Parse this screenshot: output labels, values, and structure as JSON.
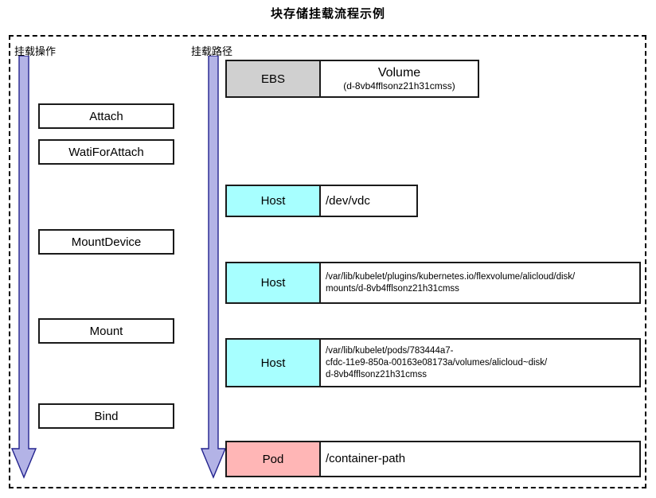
{
  "title": "块存储挂载流程示例",
  "columns": {
    "operation_caption": "挂载操作",
    "path_caption": "挂载路径"
  },
  "colors": {
    "arrow_fill": "#b3b3e6",
    "arrow_stroke": "#23238e",
    "ebs_fill": "#d0d0d0",
    "host_fill": "#a7ffff",
    "pod_fill": "#ffb6b6",
    "box_border": "#1a1a1a",
    "frame_border": "#000000"
  },
  "operations": [
    {
      "label": "Attach"
    },
    {
      "label": "WatiForAttach"
    },
    {
      "label": "MountDevice"
    },
    {
      "label": "Mount"
    },
    {
      "label": "Bind"
    }
  ],
  "paths": [
    {
      "label": "EBS",
      "fill": "ebs",
      "value_main": "Volume",
      "value_sub": "(d-8vb4fflsonz21h31cmss)"
    },
    {
      "label": "Host",
      "fill": "host",
      "value_main": "/dev/vdc"
    },
    {
      "label": "Host",
      "fill": "host",
      "value_lines": [
        "/var/lib/kubelet/plugins/kubernetes.io/flexvolume/alicloud/disk/",
        "mounts/d-8vb4fflsonz21h31cmss"
      ]
    },
    {
      "label": "Host",
      "fill": "host",
      "value_lines": [
        "/var/lib/kubelet/pods/783444a7-",
        "cfdc-11e9-850a-00163e08173a/volumes/alicloud~disk/",
        "d-8vb4fflsonz21h31cmss"
      ]
    },
    {
      "label": "Pod",
      "fill": "pod",
      "value_main": "/container-path"
    }
  ]
}
